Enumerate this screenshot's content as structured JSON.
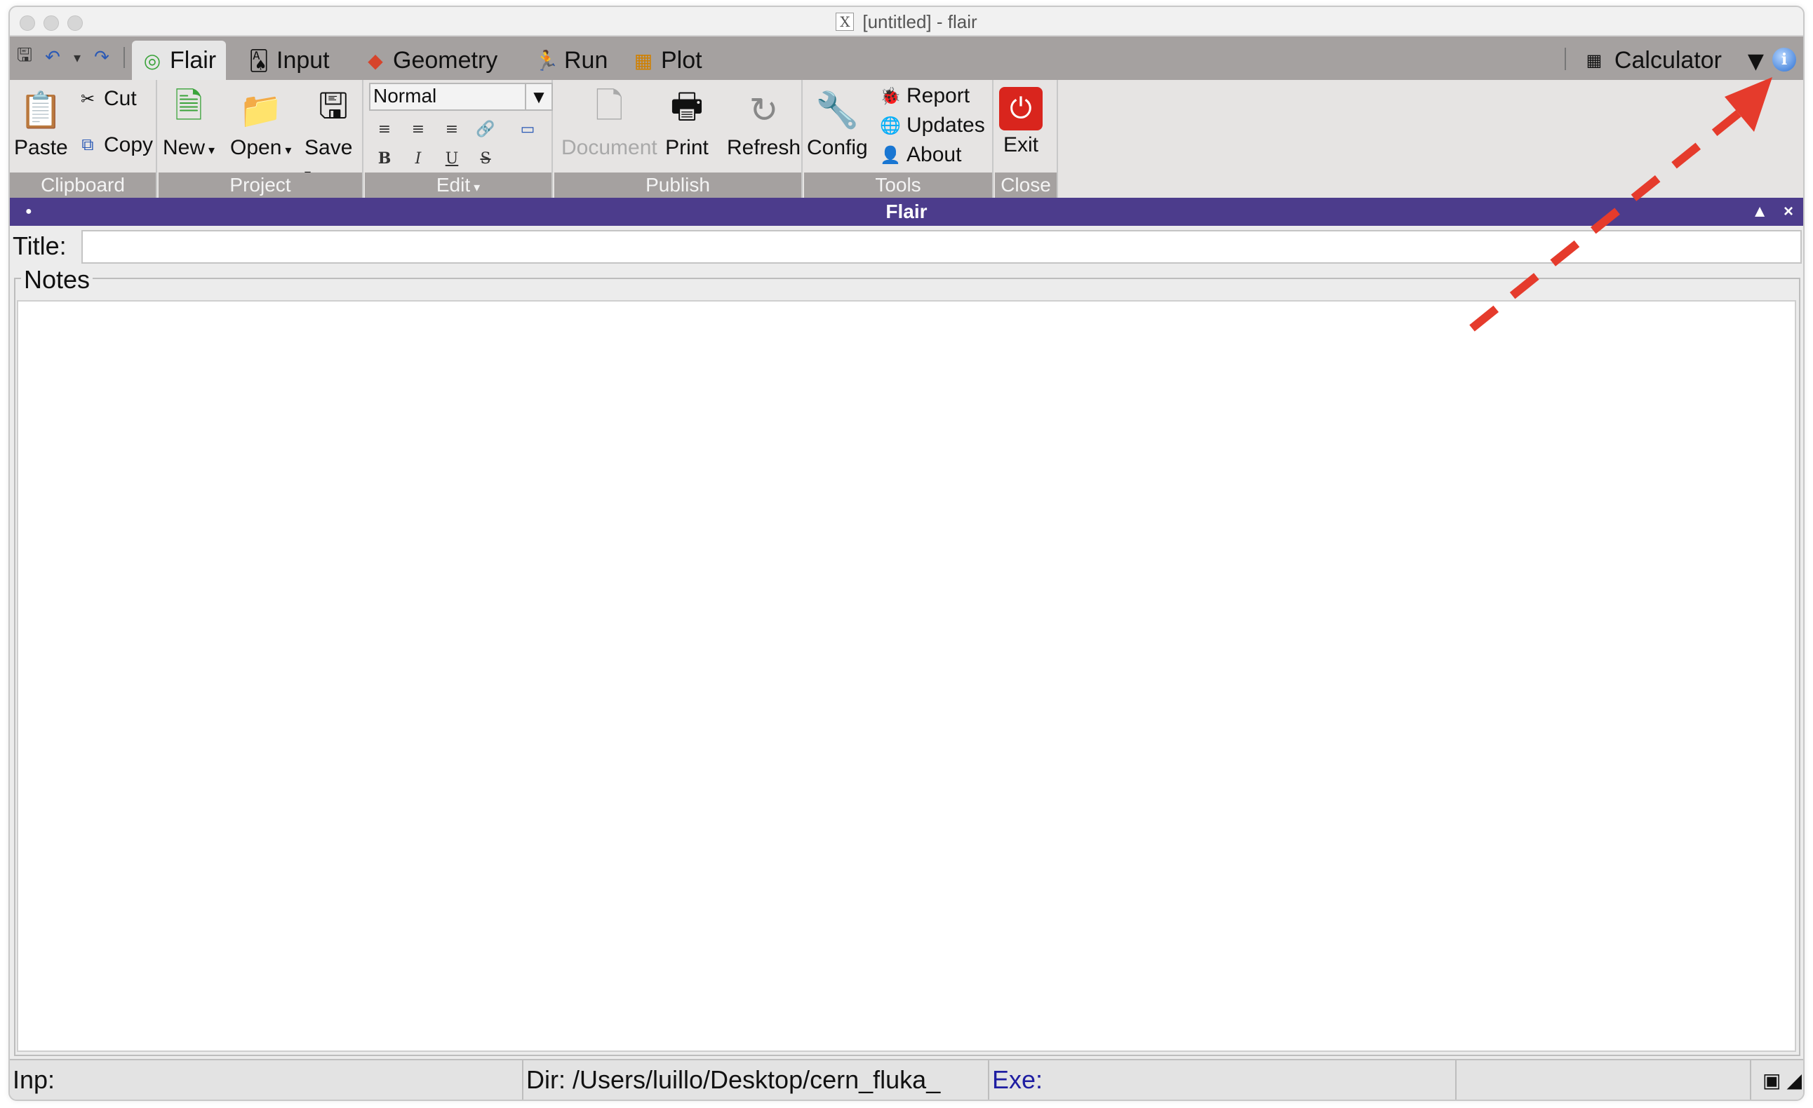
{
  "window": {
    "title": "[untitled] - flair",
    "x11_icon": "X"
  },
  "quick_access": [
    {
      "icon": "save-icon",
      "glyph": "🖫"
    },
    {
      "icon": "undo-icon",
      "glyph": "↶"
    },
    {
      "icon": "undo-dropdown-icon",
      "glyph": "▾"
    },
    {
      "icon": "redo-icon",
      "glyph": "↷"
    }
  ],
  "tabs": [
    {
      "label": "Flair",
      "icon": "flair-icon",
      "glyph": "◎",
      "active": true
    },
    {
      "label": "Input",
      "icon": "input-icon",
      "glyph": "🂡",
      "active": false
    },
    {
      "label": "Geometry",
      "icon": "geometry-icon",
      "glyph": "◆",
      "active": false
    },
    {
      "label": "Run",
      "icon": "run-icon",
      "glyph": "🏃",
      "active": false
    },
    {
      "label": "Plot",
      "icon": "plot-icon",
      "glyph": "▦",
      "active": false
    }
  ],
  "toolbar_right": {
    "calculator_label": "Calculator",
    "calculator_icon": "calculator-icon",
    "dropdown_glyph": "▼",
    "info_glyph": "i"
  },
  "ribbon": {
    "clipboard": {
      "group_label": "Clipboard",
      "paste": "Paste",
      "cut": "Cut",
      "copy": "Copy"
    },
    "project": {
      "group_label": "Project",
      "new": "New",
      "open": "Open",
      "save": "Save"
    },
    "edit": {
      "group_label": "Edit",
      "style_value": "Normal",
      "format_buttons": [
        "≡",
        "≡",
        "≡",
        "🔗",
        "▭",
        "B",
        "I",
        "U",
        "S"
      ]
    },
    "publish": {
      "group_label": "Publish",
      "document": "Document",
      "print": "Print",
      "refresh": "Refresh"
    },
    "tools": {
      "group_label": "Tools",
      "config": "Config",
      "report": "Report",
      "updates": "Updates",
      "about": "About"
    },
    "close": {
      "group_label": "Close",
      "exit": "Exit"
    }
  },
  "panel": {
    "header": "Flair",
    "dot": "●",
    "up": "▲",
    "close": "×",
    "title_label": "Title:",
    "title_value": "",
    "notes_label": "Notes",
    "notes_value": ""
  },
  "statusbar": {
    "inp": "Inp:",
    "dir": "Dir: /Users/luillo/Desktop/cern_fluka_",
    "exe": "Exe:"
  },
  "colors": {
    "tabbar": "#a5a1a0",
    "ribbon": "#e6e4e3",
    "panel_header": "#4c3c8c",
    "annotation_arrow": "#e53b2c",
    "exe_text": "#1f1ea2",
    "exit_button": "#d9251d"
  }
}
